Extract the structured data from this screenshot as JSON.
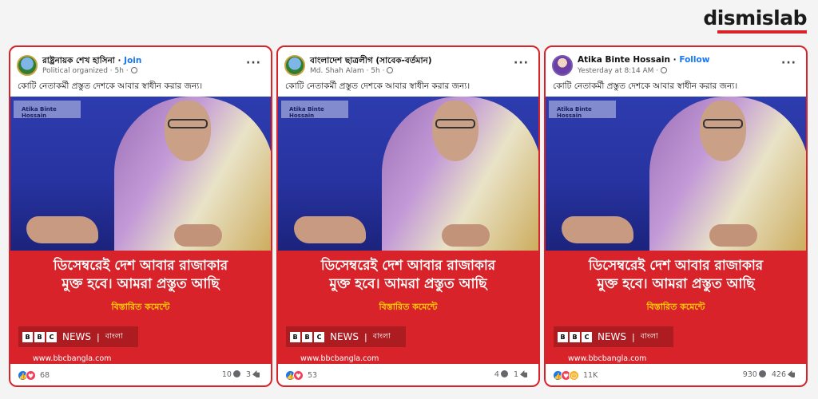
{
  "brand": {
    "logo_text": "dismislab",
    "accent": "#d8232a"
  },
  "posts": [
    {
      "author": "রাষ্ট্রনায়ক শেখ হাসিনা",
      "action": "Join",
      "sub": "Political organized · 5h ·",
      "caption": "কোটি নেতাকর্মী প্রস্তুত দেশকে আবার স্বাধীন করার জন্য।",
      "watermark": "Atika Binte Hossain",
      "headline1": "ডিসেম্বরেই দেশ আবার রাজাকার",
      "headline2": "মুক্ত হবে। আমরা প্রস্তুত আছি",
      "details": "বিস্তারিত কমেন্টে",
      "news_label": "NEWS",
      "bangla_label": "বাংলা",
      "url": "www.bbcbangla.com",
      "reactions": "68",
      "comments": "10",
      "shares": "3"
    },
    {
      "author": "বাংলাদেশ ছাত্রলীগ (সাবেক-বর্তমান)",
      "action": "",
      "sub": "Md. Shah Alam · 5h ·",
      "caption": "কোটি নেতাকর্মী প্রস্তুত দেশকে আবার স্বাধীন করার জন্য।",
      "watermark": "Atika Binte Hossain",
      "headline1": "ডিসেম্বরেই দেশ আবার রাজাকার",
      "headline2": "মুক্ত হবে। আমরা প্রস্তুত আছি",
      "details": "বিস্তারিত কমেন্টে",
      "news_label": "NEWS",
      "bangla_label": "বাংলা",
      "url": "www.bbcbangla.com",
      "reactions": "53",
      "comments": "4",
      "shares": "1"
    },
    {
      "author": "Atika Binte Hossain",
      "action": "Follow",
      "sub": "Yesterday at 8:14 AM ·",
      "caption": "কোটি নেতাকর্মী প্রস্তুত দেশকে আবার স্বাধীন করার জন্য।",
      "watermark": "Atika Binte Hossain",
      "headline1": "ডিসেম্বরেই দেশ আবার রাজাকার",
      "headline2": "মুক্ত হবে। আমরা প্রস্তুত আছি",
      "details": "বিস্তারিত কমেন্টে",
      "news_label": "NEWS",
      "bangla_label": "বাংলা",
      "url": "www.bbcbangla.com",
      "reactions": "11K",
      "comments": "930",
      "shares": "426"
    }
  ]
}
